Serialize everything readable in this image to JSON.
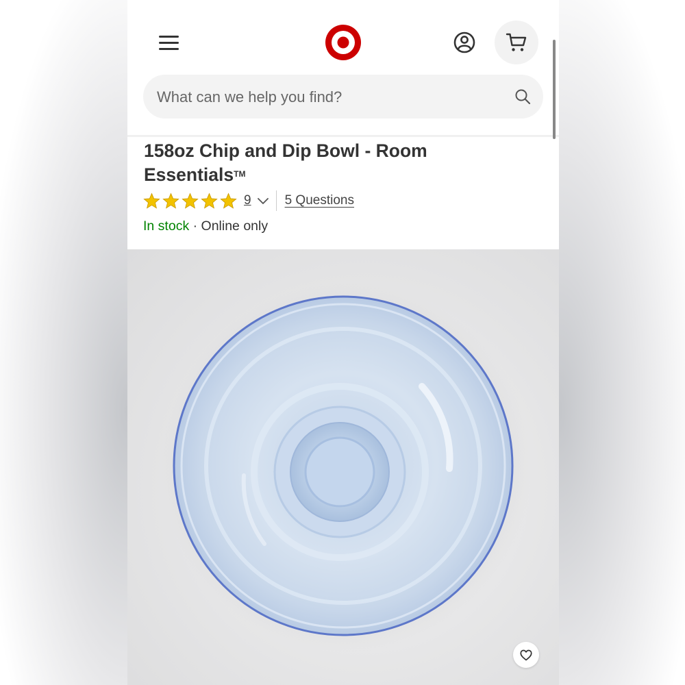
{
  "header": {
    "search": {
      "placeholder": "What can we help you find?"
    }
  },
  "product": {
    "title_main": "158oz Chip and Dip Bowl - Room Essentials",
    "title_mark": "TM",
    "rating": {
      "stars": 5,
      "count": "9"
    },
    "questions_label": "5 Questions",
    "stock_status": "In stock",
    "availability": " · Online only"
  },
  "colors": {
    "brand_red": "#cc0000",
    "star_gold": "#f2c200",
    "in_stock_green": "#008300",
    "bowl_rim": "#5d77c9",
    "bowl_glass": "#cfdcec"
  },
  "icons": {
    "menu": "hamburger-icon",
    "logo": "target-bullseye-logo",
    "account": "account-icon",
    "cart": "cart-icon",
    "search": "search-icon",
    "rating_toggle": "chevron-down-icon",
    "favorite": "heart-icon"
  }
}
